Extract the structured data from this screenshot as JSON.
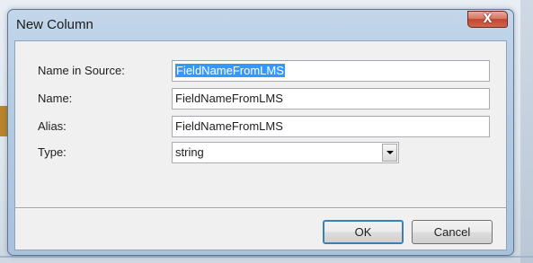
{
  "dialog": {
    "title": "New Column",
    "close_glyph": "X"
  },
  "form": {
    "name_in_source_label": "Name in Source:",
    "name_in_source_value": "FieldNameFromLMS",
    "name_label": "Name:",
    "name_value": "FieldNameFromLMS",
    "alias_label": "Alias:",
    "alias_value": "FieldNameFromLMS",
    "type_label": "Type:",
    "type_value": "string"
  },
  "buttons": {
    "ok_label": "OK",
    "cancel_label": "Cancel"
  },
  "icons": {
    "close": "close-icon",
    "dropdown": "chevron-down-icon"
  },
  "colors": {
    "selection": "#3399ff",
    "close_button": "#c2462f",
    "frame": "#b4cbe2"
  }
}
